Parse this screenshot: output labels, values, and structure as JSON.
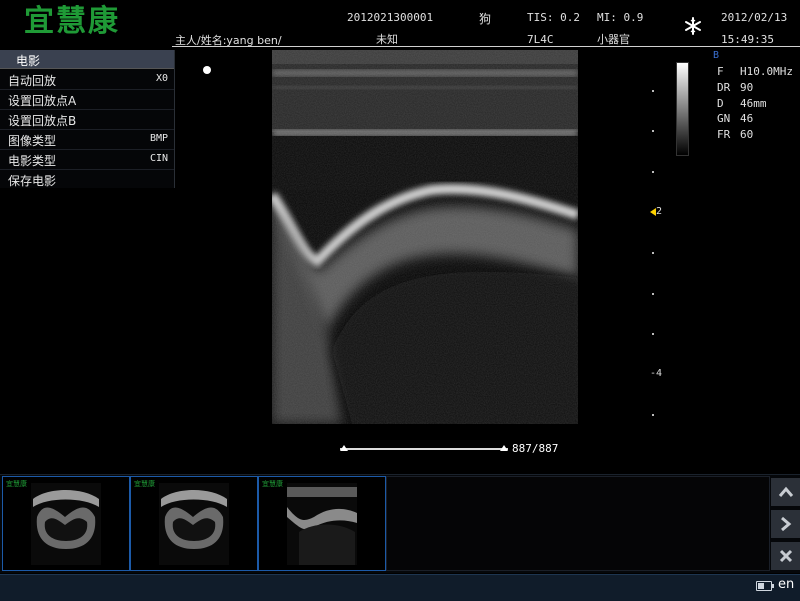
{
  "header": {
    "logo": "宜慧康",
    "patient_id": "2012021300001",
    "species": "狗",
    "tis": "TIS: 0.2",
    "mi": "MI: 0.9",
    "date": "2012/02/13",
    "owner_name": "主人/姓名:yang ben/",
    "gender": "未知",
    "probe": "7L4C",
    "preset": "小器官",
    "time": "15:49:35",
    "freeze_icon": "snowflake-icon"
  },
  "cine_menu": {
    "title": "电影",
    "items": [
      {
        "label": "自动回放",
        "value": "X0"
      },
      {
        "label": "设置回放点A",
        "value": ""
      },
      {
        "label": "设置回放点B",
        "value": ""
      },
      {
        "label": "图像类型",
        "value": "BMP"
      },
      {
        "label": "电影类型",
        "value": "CIN"
      },
      {
        "label": "保存电影",
        "value": ""
      }
    ]
  },
  "depth_scale": {
    "labels": [
      "2",
      "-4"
    ]
  },
  "params": {
    "mode": "B",
    "rows": [
      {
        "key": "F",
        "value": "H10.0MHz"
      },
      {
        "key": "DR",
        "value": "90"
      },
      {
        "key": "D",
        "value": "46mm"
      },
      {
        "key": "GN",
        "value": "46"
      },
      {
        "key": "FR",
        "value": "60"
      }
    ]
  },
  "cine": {
    "frame_counter": "887/887"
  },
  "thumbnails": {
    "count": 3,
    "logo_text": "宜慧康"
  },
  "nav": {
    "prev_icon": "chevron-up-icon",
    "next_icon": "chevron-right-icon",
    "delete_icon": "close-icon"
  },
  "status_bar": {
    "language": "en",
    "battery_level": 0.5
  },
  "colors": {
    "logo": "#1f9a36",
    "focus_marker": "#ffd200",
    "mode_label": "#3a6fd0",
    "thumb_border": "#1c5aa8"
  }
}
